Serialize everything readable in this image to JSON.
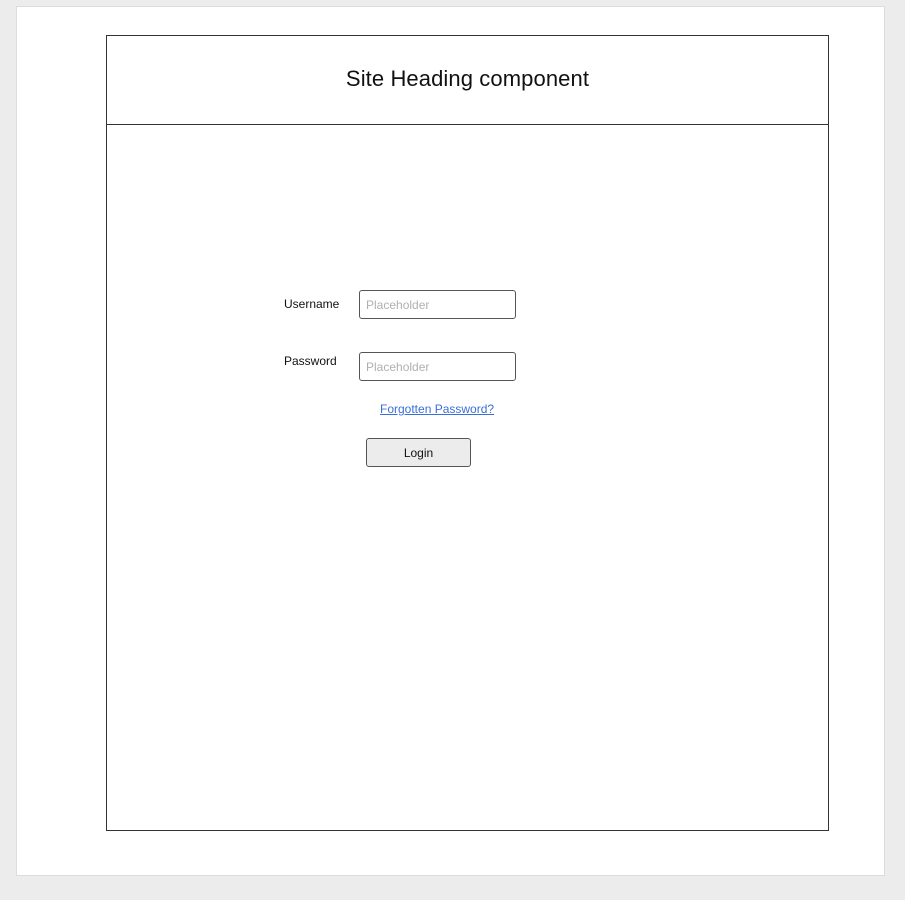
{
  "header": {
    "title": "Site Heading component"
  },
  "login_form": {
    "username_label": "Username",
    "username_placeholder": "Placeholder",
    "username_value": "",
    "password_label": "Password",
    "password_placeholder": "Placeholder",
    "password_value": "",
    "forgot_password_link": "Forgotten Password?",
    "login_button": "Login"
  },
  "colors": {
    "link": "#3a6fd8",
    "button_bg": "#ececec",
    "border": "#333333",
    "page_bg": "#ececec"
  }
}
